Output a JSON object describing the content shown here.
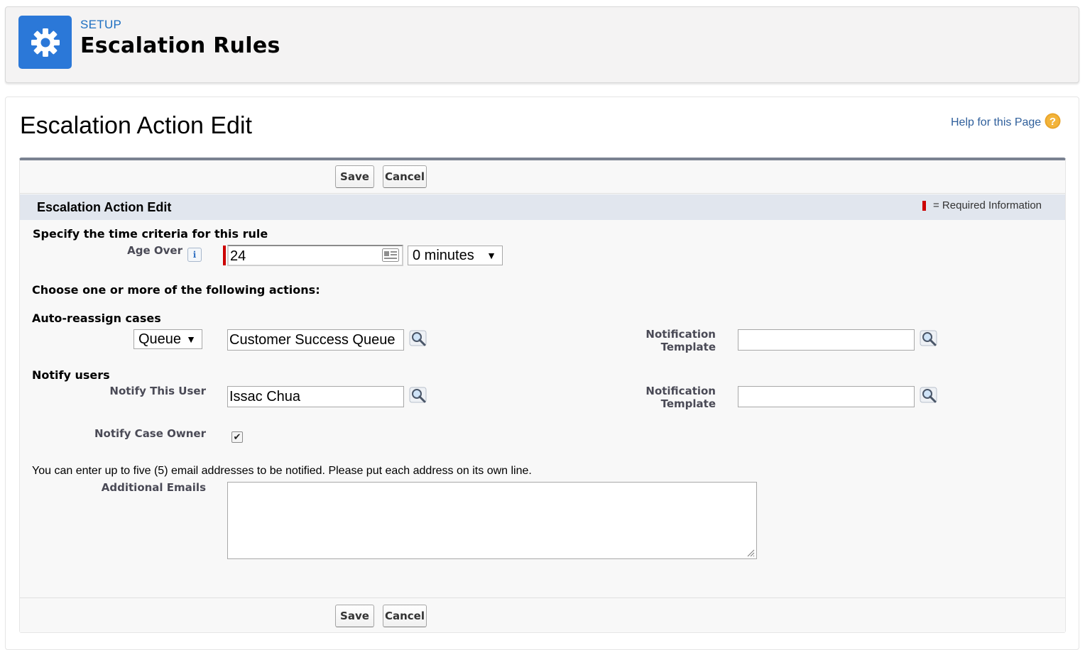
{
  "header": {
    "eyebrow": "SETUP",
    "title": "Escalation Rules",
    "icon": "gear-icon"
  },
  "page": {
    "title": "Escalation Action Edit",
    "help_link": "Help for this Page",
    "help_icon": "question-icon"
  },
  "buttons": {
    "save": "Save",
    "cancel": "Cancel"
  },
  "section": {
    "title": "Escalation Action Edit",
    "required_legend": "= Required Information",
    "required_color": "#cc0000"
  },
  "time_criteria": {
    "heading": "Specify the time criteria for this rule",
    "age_over_label": "Age Over",
    "age_over_hours": "24",
    "minutes_selected": "0 minutes"
  },
  "actions_heading": "Choose one or more of the following actions:",
  "reassign": {
    "heading": "Auto-reassign cases",
    "type_selected": "Queue",
    "assignee": "Customer Success Queue",
    "template_label": "Notification Template",
    "template_value": ""
  },
  "notify": {
    "heading": "Notify users",
    "user_label": "Notify This User",
    "user_value": "Issac Chua",
    "template_label": "Notification Template",
    "template_value": "",
    "case_owner_label": "Notify Case Owner",
    "case_owner_checked": true
  },
  "emails": {
    "helper": "You can enter up to five (5) email addresses to be notified. Please put each address on its own line.",
    "label": "Additional Emails",
    "value": ""
  },
  "colors": {
    "brand_blue": "#2b78d8",
    "link_blue": "#2f5f9b",
    "section_bar": "#e1e6ee"
  }
}
